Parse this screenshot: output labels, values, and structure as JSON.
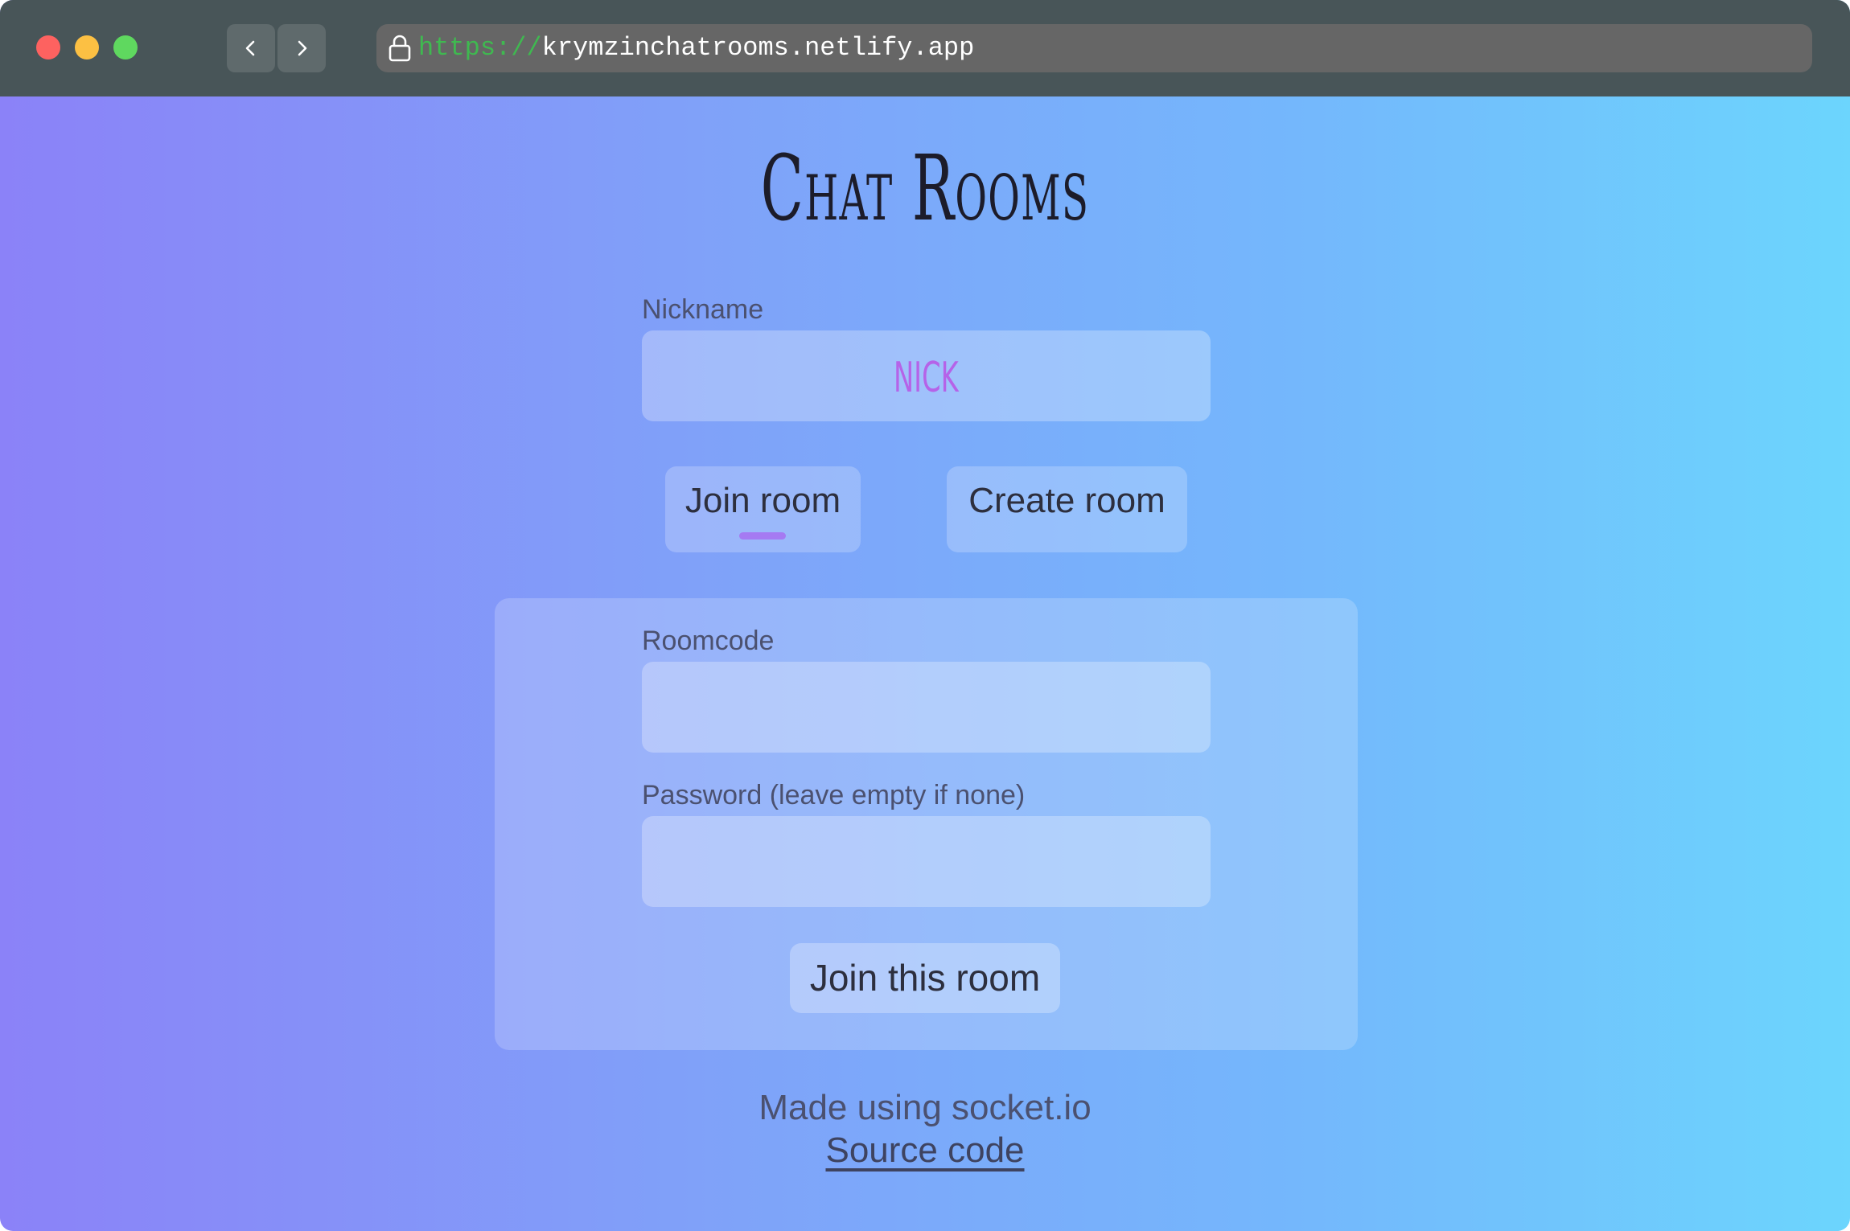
{
  "browser": {
    "url_scheme": "https://",
    "url_host": "krymzinchatrooms.netlify.app",
    "back_icon": "chevron-left-icon",
    "forward_icon": "chevron-right-icon",
    "lock_icon": "lock-icon"
  },
  "page": {
    "title": "Chat Rooms",
    "nickname_label": "Nickname",
    "nickname_value": "NICK",
    "join_room_tab": "Join room",
    "create_room_tab": "Create room",
    "roomcode_label": "Roomcode",
    "roomcode_value": "",
    "password_label": "Password (leave empty if none)",
    "password_value": "",
    "join_button": "Join this room",
    "footer_text": "Made using socket.io",
    "source_link": "Source code"
  },
  "colors": {
    "gradient_start": "#8b82f8",
    "gradient_end": "#6cd5fd",
    "nickname_text": "#b563e8",
    "active_tab_indicator": "#a57af2",
    "close_dot": "#fd6260",
    "minimize_dot": "#fcc043",
    "maximize_dot": "#5fd85f"
  }
}
